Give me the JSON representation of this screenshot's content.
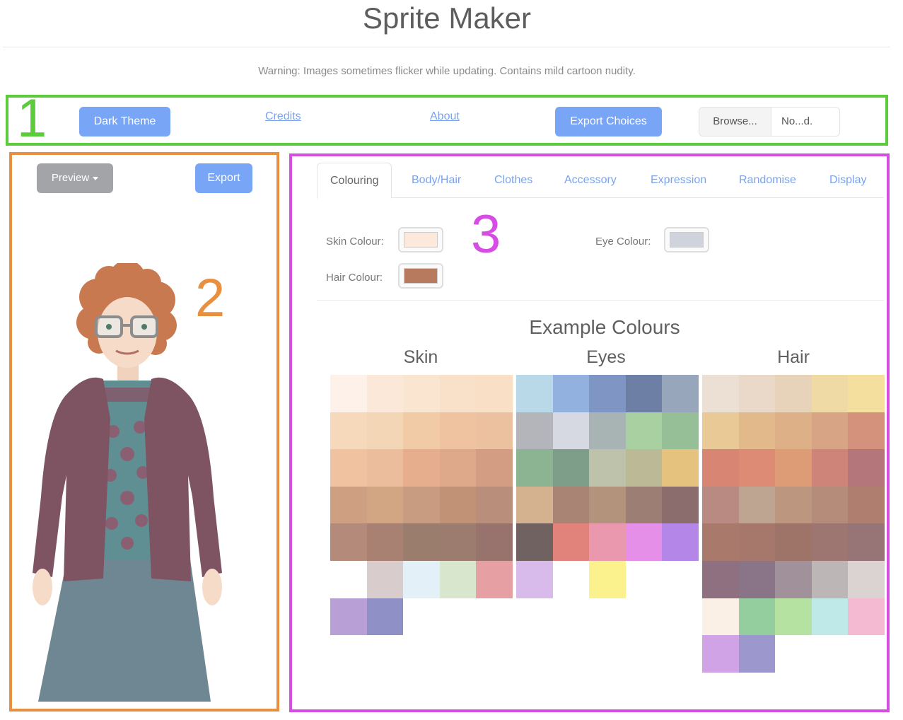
{
  "header": {
    "title": "Sprite Maker",
    "warning": "Warning: Images sometimes flicker while updating. Contains mild cartoon nudity."
  },
  "annotations": {
    "one": "1",
    "two": "2",
    "three": "3"
  },
  "annotation_colors": {
    "one": "#5ccb3c",
    "two": "#e8903f",
    "three": "#d54de3"
  },
  "toolbar": {
    "dark_theme": "Dark Theme",
    "credits": "Credits",
    "about": "About",
    "export_choices": "Export Choices",
    "browse": "Browse...",
    "file_name": "No...d."
  },
  "preview_panel": {
    "preview": "Preview",
    "export": "Export"
  },
  "tabs": [
    "Colouring",
    "Body/Hair",
    "Clothes",
    "Accessory",
    "Expression",
    "Randomise",
    "Display"
  ],
  "colouring": {
    "skin_label": "Skin Colour:",
    "skin_value": "#fde8dc",
    "eye_label": "Eye Colour:",
    "eye_value": "#cfd3dc",
    "hair_label": "Hair Colour:",
    "hair_value": "#b77a5e"
  },
  "examples": {
    "title": "Example Colours",
    "skin": {
      "title": "Skin",
      "colors": [
        "#fdf1ea",
        "#fbe8d9",
        "#fae5d1",
        "#f9e1c9",
        "#f9dfc5",
        "#f6d8bb",
        "#f3d6b5",
        "#f0cba5",
        "#efc2a0",
        "#ecc19f",
        "#f0c29f",
        "#ebbd9d",
        "#e7ae8d",
        "#dea98b",
        "#d29d83",
        "#ce9f81",
        "#d2a583",
        "#c79c80",
        "#c29277",
        "#b98e7a",
        "#b48a7a",
        "#a98173",
        "#9b7d6d",
        "#9d7c70",
        "#98726c",
        null,
        "#d9cccd",
        "#e4f0f8",
        "#d7e6cc",
        "#e69fa3",
        "#b89fd6",
        "#8f90c5"
      ]
    },
    "eyes": {
      "title": "Eyes",
      "colors": [
        "#b9d9e9",
        "#93b1de",
        "#7f96c5",
        "#6e7fa6",
        "#97a6bb",
        "#b3b5ba",
        "#d6d9e1",
        "#a8b3b3",
        "#a8d0a0",
        "#97bf97",
        "#8cb493",
        "#7f9e8a",
        "#bec2aa",
        "#bcba96",
        "#e6c27f",
        "#d4b290",
        "#a98474",
        "#b3937c",
        "#9c7e75",
        "#8c6d6d",
        "#6f6260",
        "#e1837a",
        "#ea98ad",
        "#e58fe8",
        "#b386e8",
        "#d8bbea",
        null,
        "#fbf28e",
        null,
        null
      ]
    },
    "hair": {
      "title": "Hair",
      "colors": [
        "#ebe0d3",
        "#ead9c8",
        "#e7d3ba",
        "#efd9a4",
        "#f5df9e",
        "#e9c995",
        "#e1b98b",
        "#deb087",
        "#d7a485",
        "#d4917c",
        "#d88574",
        "#dd8b74",
        "#dd9b76",
        "#cf847a",
        "#b4767a",
        "#b98a82",
        "#bda592",
        "#bd9680",
        "#b58b79",
        "#b07e6f",
        "#a97a6b",
        "#a5786b",
        "#9f7468",
        "#9d7571",
        "#977475",
        "#8e7081",
        "#8a7487",
        "#a0919b",
        "#bcb6b7",
        "#dad3d2",
        "#faf0e6",
        "#95ce9e",
        "#b5e1a1",
        "#bfe8e8",
        "#f3bad1",
        "#cfa3e6",
        "#9c97cc"
      ]
    }
  }
}
